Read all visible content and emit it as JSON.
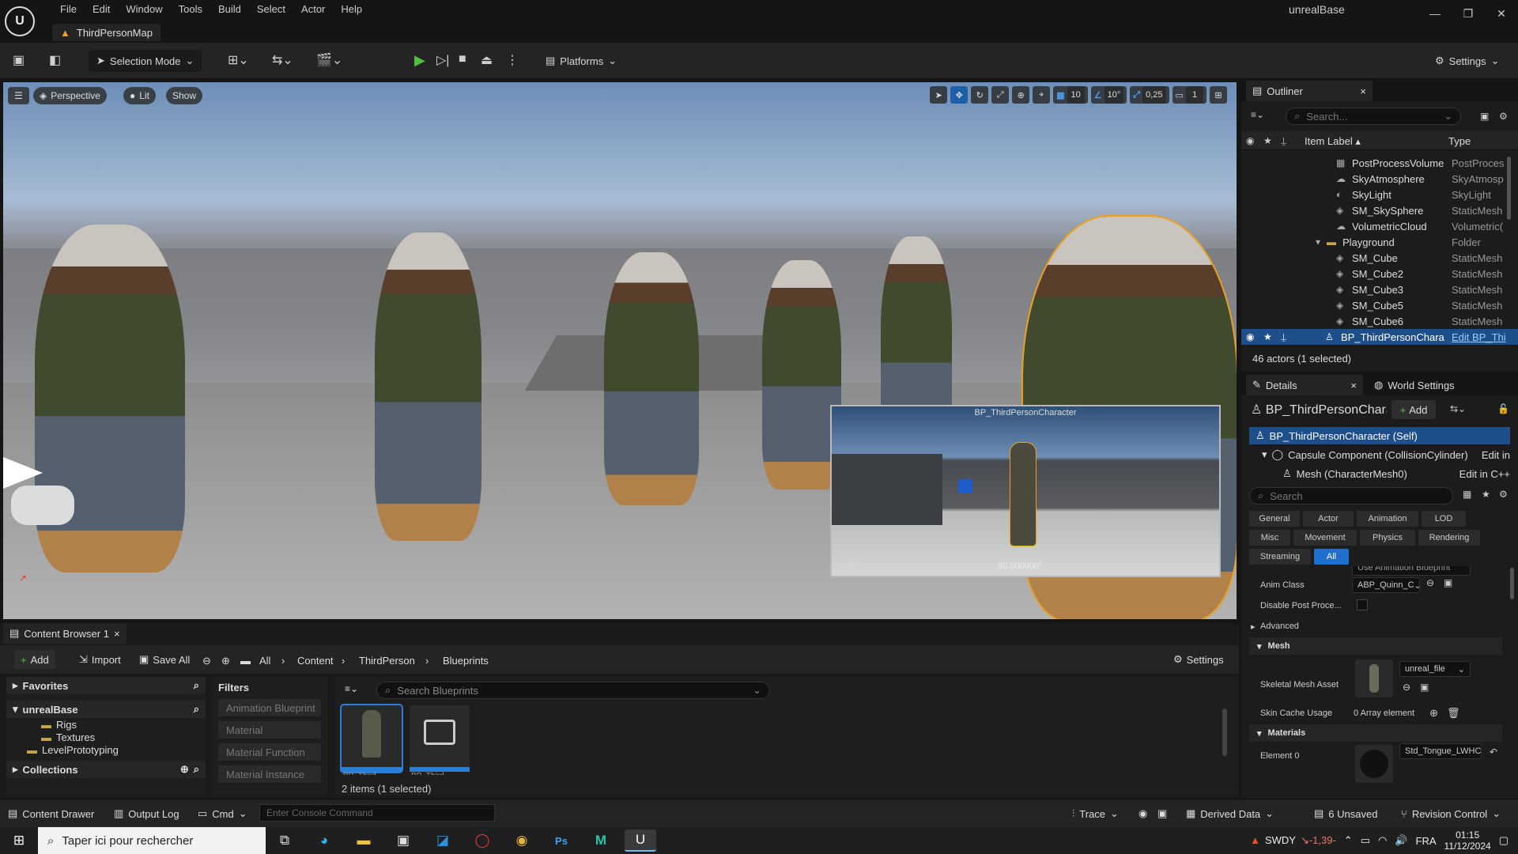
{
  "window": {
    "project_name": "unrealBase",
    "level_tab": "ThirdPersonMap"
  },
  "menu": [
    "File",
    "Edit",
    "Window",
    "Tools",
    "Build",
    "Select",
    "Actor",
    "Help"
  ],
  "toolbar": {
    "selection_mode": "Selection Mode",
    "platforms": "Platforms",
    "settings": "Settings"
  },
  "viewport": {
    "perspective": "Perspective",
    "lit": "Lit",
    "show": "Show",
    "grid_snap": "10",
    "angle_snap": "10°",
    "scale_snap": "0,25",
    "camera_speed": "1",
    "pip_title": "BP_ThirdPersonCharacter",
    "pip_value": "90.000000°"
  },
  "outliner": {
    "title": "Outliner",
    "search_placeholder": "Search...",
    "col_label": "Item Label",
    "col_type": "Type",
    "rows": [
      {
        "label": "PostProcessVolume",
        "type": "PostProces"
      },
      {
        "label": "SkyAtmosphere",
        "type": "SkyAtmosp"
      },
      {
        "label": "SkyLight",
        "type": "SkyLight"
      },
      {
        "label": "SM_SkySphere",
        "type": "StaticMesh"
      },
      {
        "label": "VolumetricCloud",
        "type": "Volumetric("
      },
      {
        "label": "Playground",
        "type": "Folder"
      },
      {
        "label": "SM_Cube",
        "type": "StaticMesh"
      },
      {
        "label": "SM_Cube2",
        "type": "StaticMesh"
      },
      {
        "label": "SM_Cube3",
        "type": "StaticMesh"
      },
      {
        "label": "SM_Cube5",
        "type": "StaticMesh"
      },
      {
        "label": "SM_Cube6",
        "type": "StaticMesh"
      }
    ],
    "selected": {
      "label": "BP_ThirdPersonChara",
      "type": "Edit BP_Thi"
    },
    "footer": "46 actors (1 selected)"
  },
  "details": {
    "tab": "Details",
    "tab2": "World Settings",
    "actor_name": "BP_ThirdPersonChara",
    "add": "Add",
    "components": [
      {
        "label": "BP_ThirdPersonCharacter (Self)",
        "action": ""
      },
      {
        "label": "Capsule Component (CollisionCylinder)",
        "action": "Edit in"
      },
      {
        "label": "Mesh (CharacterMesh0)",
        "action": "Edit in C++"
      }
    ],
    "search_placeholder": "Search",
    "categories": [
      "General",
      "Actor",
      "Animation",
      "LOD",
      "Misc",
      "Movement",
      "Physics",
      "Rendering",
      "Streaming",
      "All"
    ],
    "props": {
      "animation_mode_value": "Use Animation Blueprint",
      "anim_class_key": "Anim Class",
      "anim_class_value": "ABP_Quinn_C",
      "disable_post_key": "Disable Post Proce...",
      "advanced": "Advanced",
      "mesh_section": "Mesh",
      "skeletal_mesh_key": "Skeletal Mesh Asset",
      "skeletal_mesh_value": "unreal_file",
      "skin_cache_key": "Skin Cache Usage",
      "skin_cache_value": "0 Array element",
      "materials_section": "Materials",
      "element0_key": "Element 0",
      "element0_value": "Std_Tongue_LWHC"
    }
  },
  "content_browser": {
    "tab": "Content Browser 1",
    "add": "Add",
    "import": "Import",
    "save_all": "Save All",
    "breadcrumb": [
      "All",
      "Content",
      "ThirdPerson",
      "Blueprints"
    ],
    "settings": "Settings",
    "favorites": "Favorites",
    "project": "unrealBase",
    "folders": [
      "Rigs",
      "Textures",
      "LevelPrototyping"
    ],
    "collections": "Collections",
    "filters_title": "Filters",
    "filters": [
      "Animation Blueprint",
      "Material",
      "Material Function",
      "Material Instance"
    ],
    "search_placeholder": "Search Blueprints",
    "status": "2 items (1 selected)",
    "thumbs": [
      "BP_Third...",
      "BP_Third..."
    ]
  },
  "statusbar": {
    "content_drawer": "Content Drawer",
    "output_log": "Output Log",
    "cmd": "Cmd",
    "console_placeholder": "Enter Console Command",
    "trace": "Trace",
    "derived_data": "Derived Data",
    "unsaved": "6 Unsaved",
    "revision": "Revision Control"
  },
  "taskbar": {
    "search": "Taper ici pour rechercher",
    "stock": "SWDY",
    "stock_change": "↘-1,39-",
    "lang": "FRA",
    "time": "01:15",
    "date": "11/12/2024"
  }
}
